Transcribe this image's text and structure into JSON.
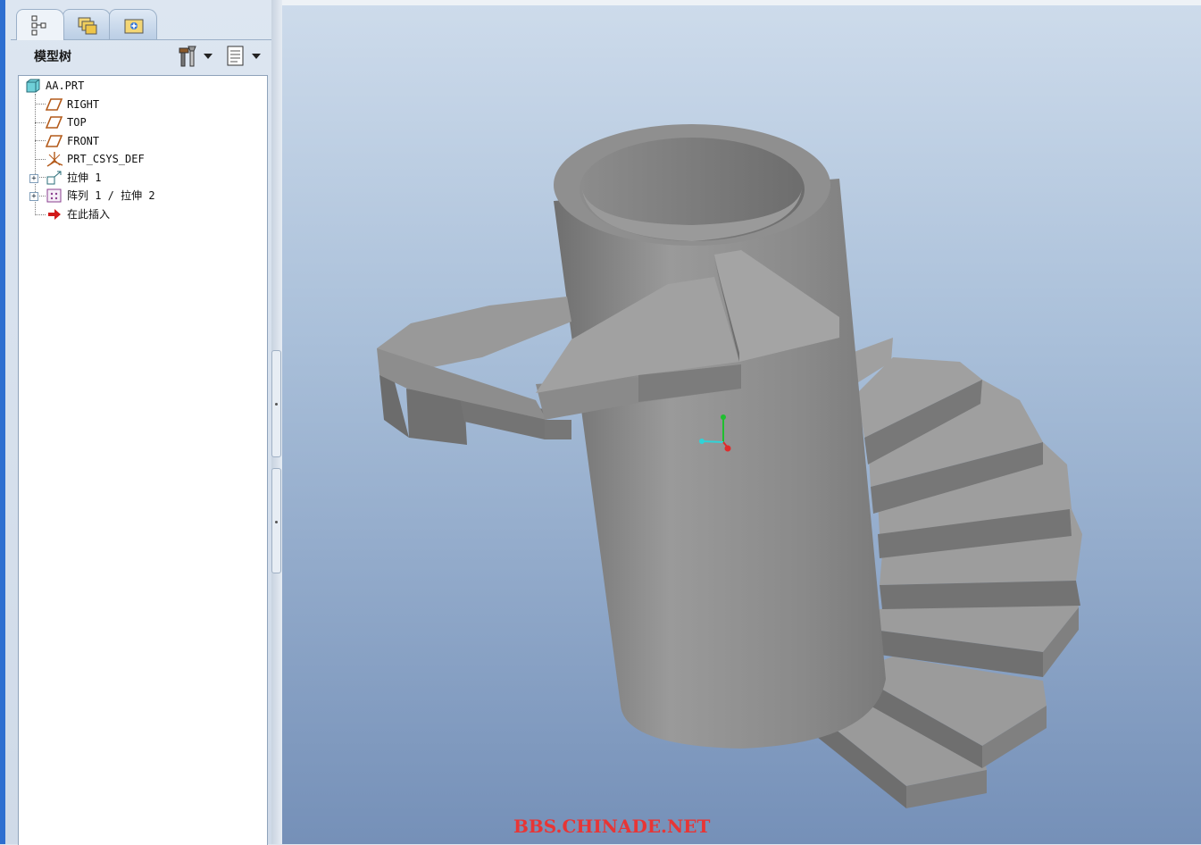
{
  "panel": {
    "title": "模型树"
  },
  "tree": {
    "items": [
      {
        "label": "AA.PRT",
        "icon": "part-icon"
      },
      {
        "label": "RIGHT",
        "icon": "datum-plane-icon"
      },
      {
        "label": "TOP",
        "icon": "datum-plane-icon"
      },
      {
        "label": "FRONT",
        "icon": "datum-plane-icon"
      },
      {
        "label": "PRT_CSYS_DEF",
        "icon": "csys-icon"
      },
      {
        "label": "拉伸 1",
        "icon": "extrude-icon"
      },
      {
        "label": "阵列 1 / 拉伸 2",
        "icon": "pattern-icon"
      },
      {
        "label": "在此插入",
        "icon": "insert-here-arrow-icon"
      }
    ]
  },
  "watermark": "BBS.CHINADE.NET",
  "colors": {
    "model_gray": "#8e8e8e",
    "viewport_top": "#cddbeb",
    "viewport_bottom": "#7590b8",
    "watermark": "#e83535"
  }
}
